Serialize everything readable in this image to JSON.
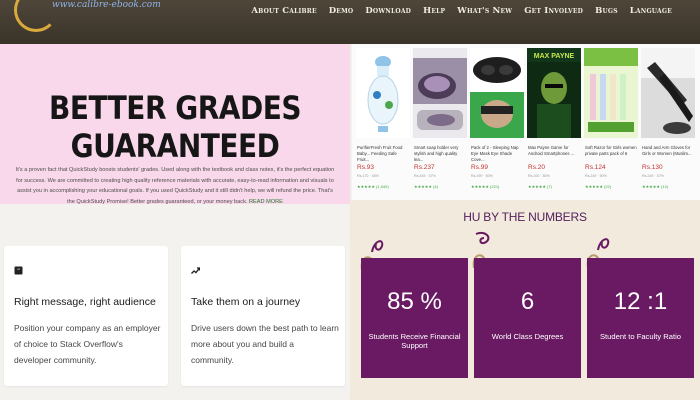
{
  "header": {
    "logo_text": "www.calibre-ebook.com",
    "nav": [
      "About Calibre",
      "Demo",
      "Download",
      "Help",
      "What's New",
      "Get Involved",
      "Bugs",
      "Language"
    ]
  },
  "hero": {
    "title": "Better Grades Guaranteed",
    "text": "It's a proven fact that QuickStudy boosts students' grades. Used along with the textbook and class notes, it's the perfect equation for success. We are committed to creating high quality reference materials with accurate, easy-to-read information and visuals to assist you in accomplishing your educational goals. If you used QuickStudy and it still didn't help, we will refund the price. That's the QuickStudy Promise! Better grades guaranteed, or your money back.",
    "read_more": "READ MORE"
  },
  "cards": [
    {
      "icon": "chat-icon",
      "title": "Right message, right audience",
      "desc": "Position your company as an employer of choice to Stack Overflow's developer community."
    },
    {
      "icon": "trend-arrow-icon",
      "title": "Take them on a journey",
      "desc": "Drive users down the best path to learn more about you and build a community."
    }
  ],
  "products": [
    {
      "name": "PurifierFresh Fruit Food Baby... Feeding Safe Fruit...",
      "price": "Rs.93",
      "mrp": "Rs.170 · 45%",
      "rating": "★★★★★ (1,040)",
      "image": "baby-feeder-image"
    },
    {
      "name": "Smart soap holder very stylish and high quality lea...",
      "price": "Rs.237",
      "mrp": "Rs.445 · 47%",
      "rating": "★★★★★ (4)",
      "image": "soap-holder-image"
    },
    {
      "name": "Pack of 2 - Sleeping Nap Eye Mask Eye Shade Cove...",
      "price": "Rs.99",
      "mrp": "Rs.199 · 50%",
      "rating": "★★★★★ (221)",
      "image": "eye-mask-image"
    },
    {
      "name": "Max Payne Game for Android Smartphones ...",
      "price": "Rs.20",
      "mrp": "Rs.100 · 80%",
      "rating": "★★★★★ (7)",
      "image": "max-payne-image"
    },
    {
      "name": "Soft Razor for Girls women private parts pack of 6",
      "price": "Rs.124",
      "mrp": "Rs.249 · 50%",
      "rating": "★★★★★ (22)",
      "image": "razor-pack-image"
    },
    {
      "name": "Hand and Arm Gloves for Girls or Women (Muslim...",
      "price": "Rs.130",
      "mrp": "Rs.249 · 47%",
      "rating": "★★★★★ (12)",
      "image": "arm-gloves-image"
    }
  ],
  "stats": {
    "title": "HU BY THE NUMBERS",
    "items": [
      {
        "number": "85 %",
        "label": "Students Receive Financial Support"
      },
      {
        "number": "6",
        "label": "World Class Degrees"
      },
      {
        "number": "12 :1",
        "label": "Student to Faculty Ratio"
      }
    ]
  },
  "colors": {
    "header_bg": "#3d362c",
    "hero_bg": "#f8d8ea",
    "stat_bg": "#6a1a63",
    "stat_title": "#54205d",
    "price": "#c23131",
    "rating": "#3fa63f"
  }
}
